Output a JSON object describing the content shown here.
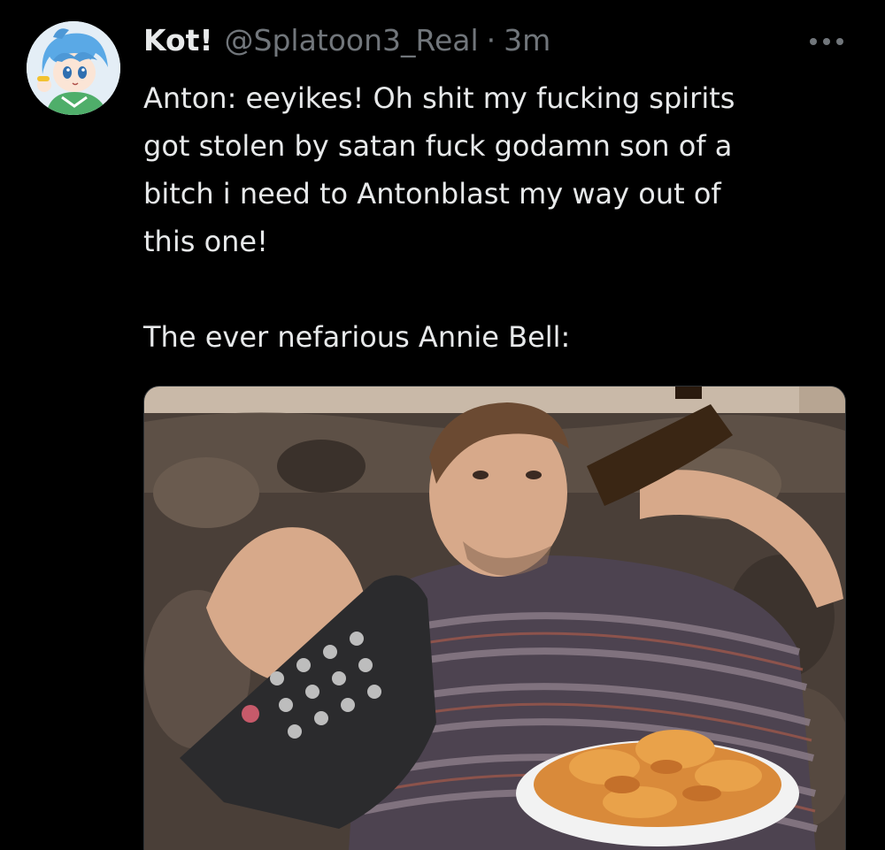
{
  "tweet": {
    "author": {
      "display_name": "Kot!",
      "handle": "@Splatoon3_Real"
    },
    "separator": "·",
    "timestamp": "3m",
    "text_lines": [
      "Anton: eeyikes! Oh shit my fucking spirits",
      "got stolen by satan fuck godamn son of a",
      "bitch i need to Antonblast my way out of",
      "this one!"
    ],
    "text_line_after_break": "The ever nefarious Annie Bell:"
  },
  "icons": {
    "more": "more-horizontal-icon",
    "avatar": "anime-avatar"
  },
  "colors": {
    "background": "#000000",
    "primary_text": "#e7e9ea",
    "secondary_text": "#71767b",
    "border": "#2f3336"
  }
}
